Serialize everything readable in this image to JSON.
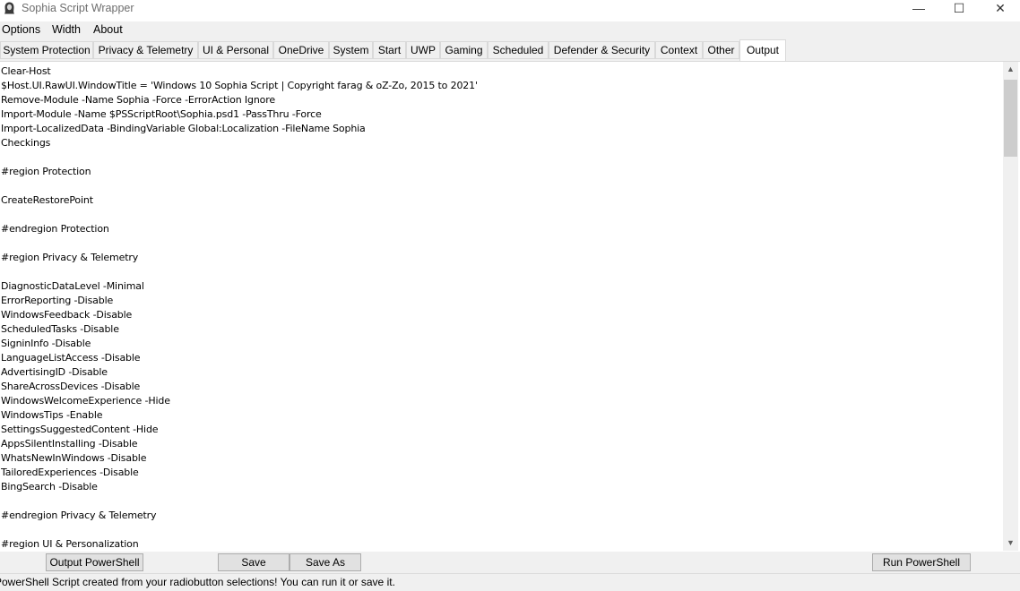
{
  "window": {
    "title": "Sophia Script Wrapper",
    "minimize_glyph": "—",
    "maximize_glyph": "☐",
    "close_glyph": "✕"
  },
  "menu": [
    "Options",
    "Width",
    "About"
  ],
  "tabs": [
    "System Protection",
    "Privacy & Telemetry",
    "UI & Personal",
    "OneDrive",
    "System",
    "Start",
    "UWP",
    "Gaming",
    "Scheduled",
    "Defender & Security",
    "Context",
    "Other",
    "Output"
  ],
  "active_tab": "Output",
  "output_lines": [
    "Clear-Host",
    "$Host.UI.RawUI.WindowTitle = 'Windows 10 Sophia Script | Copyright farag & oZ-Zo, 2015 to 2021'",
    "Remove-Module -Name Sophia -Force -ErrorAction Ignore",
    "Import-Module -Name $PSScriptRoot\\Sophia.psd1 -PassThru -Force",
    "Import-LocalizedData -BindingVariable Global:Localization -FileName Sophia",
    "Checkings",
    "",
    "#region Protection",
    "",
    "CreateRestorePoint",
    "",
    "#endregion Protection",
    "",
    "#region Privacy & Telemetry",
    "",
    "DiagnosticDataLevel -Minimal",
    "ErrorReporting -Disable",
    "WindowsFeedback -Disable",
    "ScheduledTasks -Disable",
    "SigninInfo -Disable",
    "LanguageListAccess -Disable",
    "AdvertisingID -Disable",
    "ShareAcrossDevices -Disable",
    "WindowsWelcomeExperience -Hide",
    "WindowsTips -Enable",
    "SettingsSuggestedContent -Hide",
    "AppsSilentInstalling -Disable",
    "WhatsNewInWindows -Disable",
    "TailoredExperiences -Disable",
    "BingSearch -Disable",
    "",
    "#endregion Privacy & Telemetry",
    "",
    "#region UI & Personalization"
  ],
  "buttons": {
    "output_powershell": "Output PowerShell",
    "save": "Save",
    "save_as": "Save As",
    "run_powershell": "Run PowerShell"
  },
  "status": "PowerShell Script created from your radiobutton selections! You can run it or save it.",
  "icons": {
    "app": "sophia-icon",
    "scroll_up": "chevron-up-icon",
    "scroll_down": "chevron-down-icon"
  }
}
